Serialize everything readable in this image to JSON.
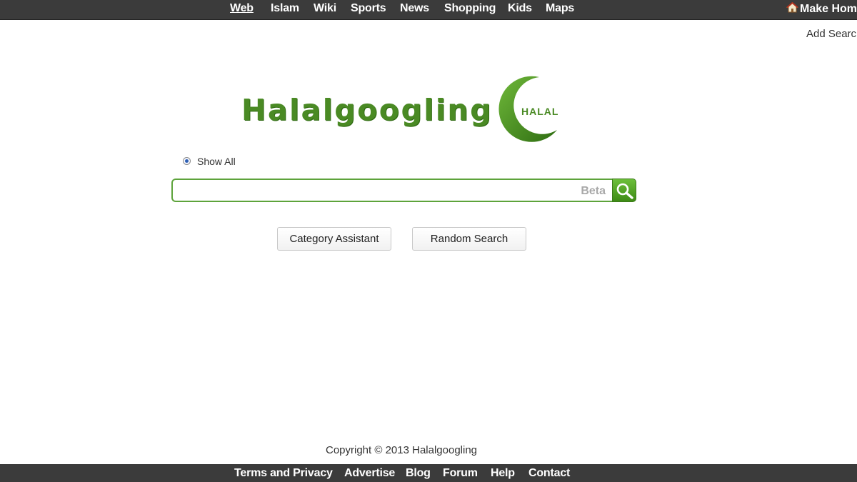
{
  "top_nav": {
    "items": [
      {
        "label": "Web",
        "active": true
      },
      {
        "label": "Islam",
        "active": false
      },
      {
        "label": "Wiki",
        "active": false
      },
      {
        "label": "Sports",
        "active": false
      },
      {
        "label": "News",
        "active": false
      },
      {
        "label": "Shopping",
        "active": false
      },
      {
        "label": "Kids",
        "active": false
      },
      {
        "label": "Maps",
        "active": false
      }
    ],
    "make_home_label": "Make Home"
  },
  "add_search_label": "Add Search",
  "logo": {
    "text": "Halalgoogling",
    "moon_label": "HALAL",
    "brand_color": "#4a8a24"
  },
  "filter": {
    "radio_label": "Show All",
    "selected": true
  },
  "search": {
    "value": "",
    "placeholder": "",
    "badge": "Beta",
    "button_icon": "magnifier-icon"
  },
  "buttons": {
    "category_assistant": "Category Assistant",
    "random_search": "Random Search"
  },
  "footer": {
    "copyright": "Copyright © 2013 Halalgoogling",
    "links": [
      "Terms and Privacy",
      "Advertise",
      "Blog",
      "Forum",
      "Help",
      "Contact"
    ]
  },
  "colors": {
    "bar_background": "#3b3b3b",
    "accent_green": "#5da33b"
  }
}
